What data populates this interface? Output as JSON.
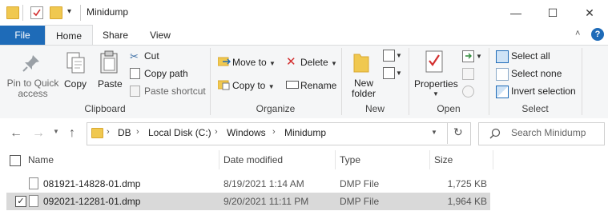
{
  "window": {
    "title": "Minidump",
    "minimize_glyph": "—",
    "maximize_glyph": "☐",
    "close_glyph": "✕"
  },
  "tabs": [
    "File",
    "Home",
    "Share",
    "View"
  ],
  "ribbon": {
    "clipboard": {
      "label": "Clipboard",
      "pin_to_quick_access": [
        "Pin to Quick",
        "access"
      ],
      "copy": "Copy",
      "paste": "Paste",
      "cut": "Cut",
      "copy_path": "Copy path",
      "paste_shortcut": "Paste shortcut"
    },
    "organize": {
      "label": "Organize",
      "move_to": "Move to",
      "copy_to": "Copy to",
      "delete": "Delete",
      "rename": "Rename"
    },
    "new": {
      "label": "New",
      "new_folder": [
        "New",
        "folder"
      ]
    },
    "open": {
      "label": "Open",
      "properties": "Properties"
    },
    "select": {
      "label": "Select",
      "select_all": "Select all",
      "select_none": "Select none",
      "invert_selection": "Invert selection"
    }
  },
  "address": {
    "breadcrumb": [
      "DB",
      "Local Disk (C:)",
      "Windows",
      "Minidump"
    ],
    "search_placeholder": "Search Minidump"
  },
  "file_list": {
    "columns": [
      "Name",
      "Date modified",
      "Type",
      "Size"
    ],
    "rows": [
      {
        "name": "081921-14828-01.dmp",
        "date": "8/19/2021 1:14 AM",
        "type": "DMP File",
        "size": "1,725 KB",
        "selected": false
      },
      {
        "name": "092021-12281-01.dmp",
        "date": "9/20/2021 11:11 PM",
        "type": "DMP File",
        "size": "1,964 KB",
        "selected": true
      }
    ]
  },
  "colors": {
    "file_tab": "#1e6bb8",
    "accent_blue": "#1e6bb8",
    "help_blue": "#1e6bb8",
    "folder_yellow": "#f0c850",
    "delete_red": "#d32f2f",
    "selected_row": "#d9d9d9"
  }
}
